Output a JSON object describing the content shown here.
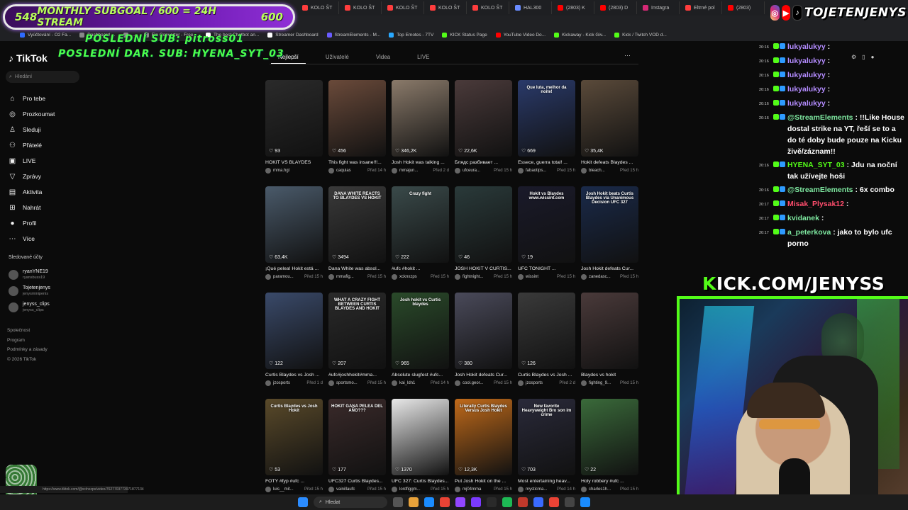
{
  "browser": {
    "tabs": [
      {
        "label": "KOLO ŠT",
        "color": "#ff3d3d"
      },
      {
        "label": "KOLO ŠT",
        "color": "#ff3d3d"
      },
      {
        "label": "KOLO ŠT",
        "color": "#ff3d3d"
      },
      {
        "label": "KOLO ŠT",
        "color": "#ff3d3d"
      },
      {
        "label": "KOLO ŠT",
        "color": "#ff3d3d"
      },
      {
        "label": "HAL300",
        "color": "#6a8cff"
      },
      {
        "label": "(2803) K",
        "color": "#ff0000"
      },
      {
        "label": "(2803) D",
        "color": "#ff0000"
      },
      {
        "label": "Instagra",
        "color": "#d62976"
      },
      {
        "label": "Eltrné pol",
        "color": "#ff3d3d"
      },
      {
        "label": "(2803)",
        "color": "#ff0000"
      }
    ],
    "bookmarks": [
      {
        "label": "Vyúčtování - O2 Fa...",
        "color": "#2d6bff"
      },
      {
        "label": "Dashboard ...",
        "color": "#888888"
      },
      {
        "label": "...",
        "color": "#888888"
      },
      {
        "label": "Elo Converter - Free...",
        "color": "#888888"
      },
      {
        "label": "The best Chatbot an...",
        "color": "#ffffff"
      },
      {
        "label": "Streamer Dashboard",
        "color": "#ffffff"
      },
      {
        "label": "StreamElements - M...",
        "color": "#6a5cff"
      },
      {
        "label": "Top Emotes - 7TV",
        "color": "#29a9ff"
      },
      {
        "label": "KICK Status Page",
        "color": "#53fc18"
      },
      {
        "label": "YouTube Video Do...",
        "color": "#ff0000"
      },
      {
        "label": "Kickaway - Kick Giv...",
        "color": "#53fc18"
      },
      {
        "label": "Kick / Twitch VOD d...",
        "color": "#53fc18"
      }
    ]
  },
  "overlay": {
    "subgoal_left": "548",
    "subgoal_center": "MONTHLY SUBGOAL / 600 = 24H STREAM",
    "subgoal_right": "600",
    "last_sub": "POSLEDNÍ SUB: pitross01",
    "last_dar": "POSLEDNÍ DAR. SUB: HYENA_SYT_03",
    "social_name": "TOJETENJENYS",
    "kick_prefix": "K",
    "kick_rest": "ICK.COM/JENYSS"
  },
  "sidebar": {
    "logo": "TikTok",
    "search_placeholder": "Hledání",
    "nav": [
      {
        "label": "Pro tebe",
        "icon": "home-icon",
        "glyph": "⌂"
      },
      {
        "label": "Prozkoumat",
        "icon": "compass-icon",
        "glyph": "◎"
      },
      {
        "label": "Sleduji",
        "icon": "following-icon",
        "glyph": "♙"
      },
      {
        "label": "Přátelé",
        "icon": "friends-icon",
        "glyph": "⚇"
      },
      {
        "label": "LIVE",
        "icon": "live-icon",
        "glyph": "▣"
      },
      {
        "label": "Zprávy",
        "icon": "messages-icon",
        "glyph": "▽"
      },
      {
        "label": "Aktivita",
        "icon": "activity-icon",
        "glyph": "▤",
        "badge": "54"
      },
      {
        "label": "Nahrát",
        "icon": "upload-icon",
        "glyph": "⊞"
      },
      {
        "label": "Profil",
        "icon": "profile-icon",
        "glyph": "●"
      },
      {
        "label": "Více",
        "icon": "more-icon",
        "glyph": "⋯"
      }
    ],
    "followed_heading": "Sledované účty",
    "followed": [
      {
        "name": "ryanYNE19",
        "handle": "ryansbuss19"
      },
      {
        "name": "Tojetenjenys",
        "handle": "jenysminipenis"
      },
      {
        "name": "jenyss_clips",
        "handle": "jenyss_clips"
      }
    ],
    "footer": [
      "Společnost",
      "Program",
      "Podmínky a zásady",
      "© 2026 TikTok"
    ],
    "status_url": "https://www.tiktok.com/@xclnxzps/video/7627703773971877134"
  },
  "main": {
    "tabs": [
      "Nejlepší",
      "Uživatelé",
      "Videa",
      "LIVE"
    ],
    "active_tab": 0,
    "more": "···",
    "videos": [
      {
        "count": "93",
        "title": "HOKIT VS BLAYDES",
        "user": "mma.hgl",
        "time": "",
        "bg": "#2a2a2a",
        "overlay": ""
      },
      {
        "count": "456",
        "title": "This fight was insane!!!...",
        "user": "caquias",
        "time": "Před 14 h",
        "bg": "#6a4a3a",
        "overlay": ""
      },
      {
        "count": "346,2K",
        "title": "Josh Hokit was talking ...",
        "user": "mmajun...",
        "time": "Před 2 d",
        "bg": "#8a7a6a",
        "overlay": ""
      },
      {
        "count": "22,6K",
        "title": "Блядс разбивает ...",
        "user": "ufceura...",
        "time": "Před 15 h",
        "bg": "#4a3a3a",
        "overlay": ""
      },
      {
        "count": "669",
        "title": "Essece, guerra total! ...",
        "user": "fabaotips...",
        "time": "Před 15 h",
        "bg": "#2a3a6a",
        "overlay": "Que luta, melhor da noite!"
      },
      {
        "count": "35,4K",
        "title": "Hokit defeats Blaydes ...",
        "user": "bleach...",
        "time": "Před 15 h",
        "bg": "#5a4a3a",
        "overlay": ""
      },
      {
        "count": "63,4K",
        "title": "¡Qué pelea! Hokit está ...",
        "user": "paramou...",
        "time": "Před 15 h",
        "bg": "#4a5a6a",
        "overlay": ""
      },
      {
        "count": "3494",
        "title": "Dana White was absol...",
        "user": "mmafig...",
        "time": "Před 15 h",
        "bg": "#3a3a3a",
        "overlay": "DANA WHITE REACTS TO BLAYDES VS HOKIT"
      },
      {
        "count": "222",
        "title": "#ufc #hokit ...",
        "user": "xcknxzps",
        "time": "Před 15 h",
        "bg": "#3a4a4a",
        "overlay": "Crazy fight"
      },
      {
        "count": "46",
        "title": "JOSH HOKIT V CURTIS...",
        "user": "fightnight...",
        "time": "Před 15 h",
        "bg": "#2a3a3a",
        "overlay": ""
      },
      {
        "count": "19",
        "title": "UFC TONIGHT ...",
        "user": "wissint",
        "time": "Před 15 h",
        "bg": "#1a1a2a",
        "overlay": "Hokit vs Blaydes www.wissint.com"
      },
      {
        "count": "",
        "title": "Josh Hokit defeats Cur...",
        "user": "zanedasc...",
        "time": "Před 15 h",
        "bg": "#1a2a4a",
        "overlay": "Josh Hokit beats Curtis Blaydes via Unanimous Decision UFC 327"
      },
      {
        "count": "122",
        "title": "Curtis Blaydes vs Josh ...",
        "user": "jzosports",
        "time": "Před 1 d",
        "bg": "#3a4a6a",
        "overlay": ""
      },
      {
        "count": "207",
        "title": "#ufc#joshhokit#mma...",
        "user": "sportsmo...",
        "time": "Před 15 h",
        "bg": "#2a2a2a",
        "overlay": "WHAT A CRAZY FIGHT BETWEEN CURTIS BLAYDES AND HOKIT"
      },
      {
        "count": "965",
        "title": "Absolute slugfest #ufc...",
        "user": "kai_ldn1",
        "time": "Před 14 h",
        "bg": "#2a4a2a",
        "overlay": "Josh hokit vs Curtis blaydes"
      },
      {
        "count": "380",
        "title": "Josh Hokit defeats Cur...",
        "user": "cool.geor...",
        "time": "Před 15 h",
        "bg": "#4a4a5a",
        "overlay": ""
      },
      {
        "count": "126",
        "title": "Curtis Blaydes vs Josh ...",
        "user": "jzosports",
        "time": "Před 2 d",
        "bg": "#3a3a3a",
        "overlay": ""
      },
      {
        "count": "",
        "title": "Blaydes vs hokit",
        "user": "fighting_9...",
        "time": "Před 15 h",
        "bg": "#4a3a3a",
        "overlay": ""
      },
      {
        "count": "53",
        "title": "FOTY #fyp #ufc ...",
        "user": "luis__mit...",
        "time": "Před 15 h",
        "bg": "#5a4a2a",
        "overlay": "Curtis Blaydes vs Josh Hokit"
      },
      {
        "count": "177",
        "title": "UFC327 Curtis Blaydes...",
        "user": "vainillaufc",
        "time": "Před 15 h",
        "bg": "#3a2a2a",
        "overlay": "HOKIT GANA PELEA DEL AÑO???"
      },
      {
        "count": "1370",
        "title": "UFC 327: Curtis Blaydes...",
        "user": "lordfiggm...",
        "time": "Před 15 h",
        "bg": "#e8e8e8",
        "overlay": ""
      },
      {
        "count": "12,3K",
        "title": "Put Josh Hokit on the ...",
        "user": "mj04mma",
        "time": "Před 15 h",
        "bg": "#c06a1a",
        "overlay": "Literally Curtis Blaydes Versus Josh Hokit"
      },
      {
        "count": "703",
        "title": "Most entertaining heav...",
        "user": "mysticma...",
        "time": "Před 14 h",
        "bg": "#2a2a3a",
        "overlay": "New favorite Heavyweight Bro son im crime"
      },
      {
        "count": "22",
        "title": "Holy robbery #ufc ...",
        "user": "charles1h...",
        "time": "Před 15 h",
        "bg": "#3a6a3a",
        "overlay": ""
      }
    ]
  },
  "chat": {
    "messages": [
      {
        "time": "20:16",
        "user": "lukyalukyy",
        "text": ":",
        "color": "#b48cff"
      },
      {
        "time": "20:16",
        "user": "lukyalukyy",
        "text": ":",
        "color": "#b48cff"
      },
      {
        "time": "20:16",
        "user": "lukyalukyy",
        "text": ":",
        "color": "#b48cff"
      },
      {
        "time": "20:16",
        "user": "lukyalukyy",
        "text": ":",
        "color": "#b48cff"
      },
      {
        "time": "20:16",
        "user": "lukyalukyy",
        "text": ":",
        "color": "#b48cff"
      },
      {
        "time": "20:16",
        "user": "@StreamElements",
        "text": ": !!Like House dostal strike na YT, řeší se to a do té doby bude pouze na Kicku živě/záznam!!",
        "color": "#7ee8a0"
      },
      {
        "time": "20:16",
        "user": "HYENA_SYT_03",
        "text": ": Jdu na noční tak užívejte hoši",
        "color": "#53fc18"
      },
      {
        "time": "20:16",
        "user": "@StreamElements",
        "text": ": 6x combo",
        "color": "#7ee8a0"
      },
      {
        "time": "20:17",
        "user": "Misak_Plysak12",
        "text": ":",
        "color": "#ff4d6d"
      },
      {
        "time": "20:17",
        "user": "kvidanek",
        "text": ":",
        "color": "#7ee8a0"
      },
      {
        "time": "20:17",
        "user": "a_peterkova",
        "text": ": jako to bylo ufc porno",
        "color": "#7ee8a0"
      }
    ]
  },
  "taskbar": {
    "search_placeholder": "Hledat"
  },
  "colors": {
    "accent_kick": "#53fc18",
    "tiktok_red": "#fe2c55"
  }
}
